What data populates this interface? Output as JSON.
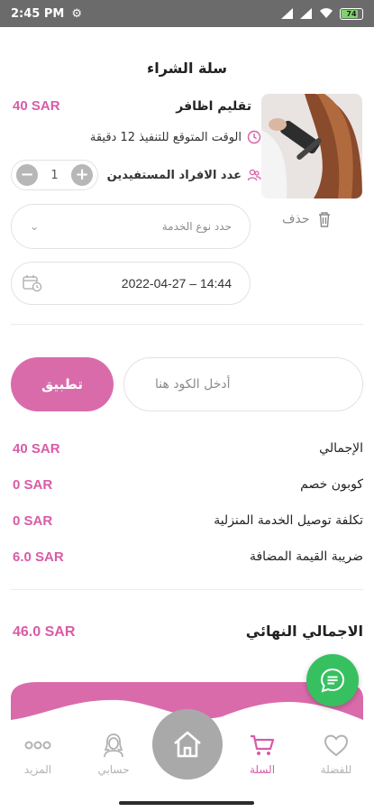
{
  "status_bar": {
    "time": "2:45 PM",
    "battery": "74"
  },
  "cart": {
    "title": "سلة الشراء",
    "item": {
      "name": "تقليم اظافر",
      "price": "40 SAR",
      "duration_text": "الوقت المتوقع للتنفيذ 12 دقيقة",
      "beneficiaries_label": "عدد الافراد المستفيدين",
      "quantity": "1",
      "delete_label": "حذف",
      "service_type_placeholder": "حدد نوع الخدمة",
      "datetime": "2022-04-27 – 14:44"
    }
  },
  "coupon": {
    "placeholder": "أدخل الكود هنا",
    "apply_label": "تطبيق"
  },
  "summary": {
    "rows": [
      {
        "label": "الإجمالي",
        "value": "40 SAR"
      },
      {
        "label": "كوبون خصم",
        "value": "0 SAR"
      },
      {
        "label": "تكلفة توصيل الخدمة المنزلية",
        "value": "0 SAR"
      },
      {
        "label": "ضريبة القيمة المضافة",
        "value": "6.0 SAR"
      }
    ],
    "total_label": "الاجمالي النهائي",
    "total_value": "46.0 SAR"
  },
  "nav": {
    "favorites": "للفضلة",
    "cart": "السلة",
    "account": "حسابي",
    "more": "المزيد"
  },
  "colors": {
    "accent": "#d75ca6",
    "chat": "#37c060"
  }
}
